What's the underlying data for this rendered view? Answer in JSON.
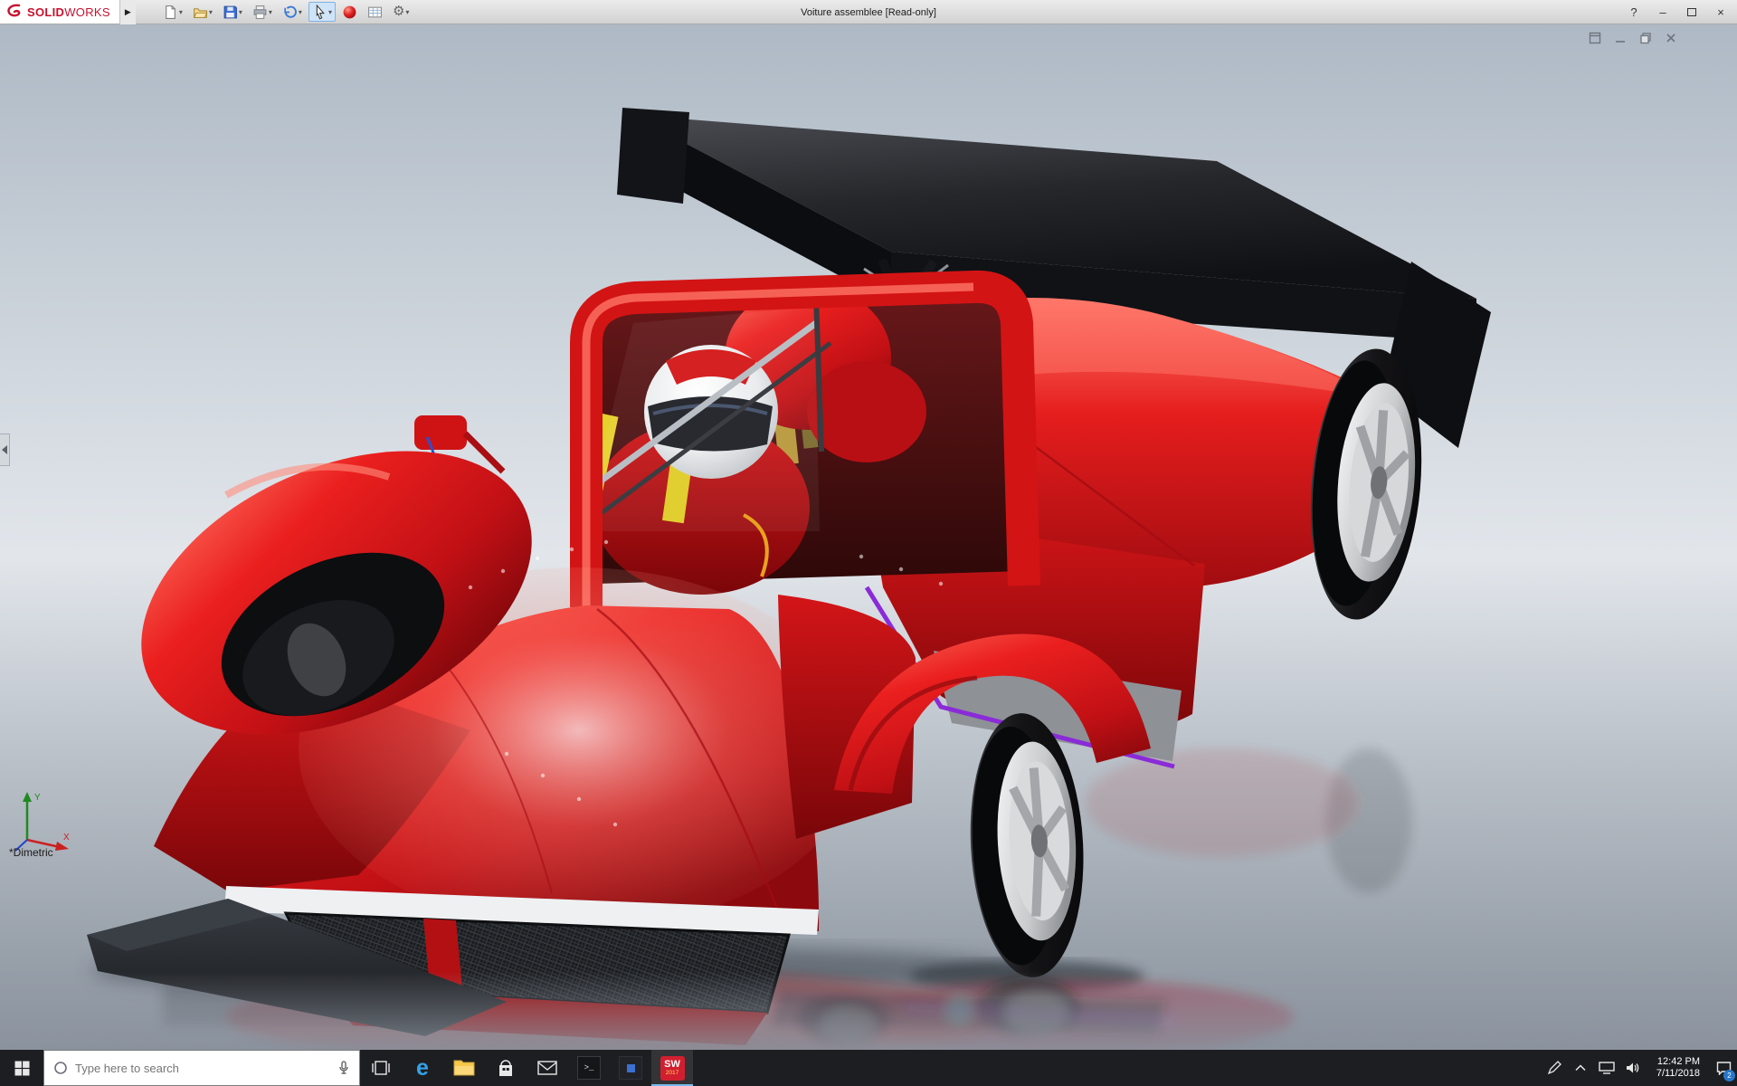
{
  "titlebar": {
    "brand": {
      "solid": "SOLID",
      "works": "WORKS"
    },
    "expand_glyph": "▶",
    "title": "Voiture assemblee [Read-only]",
    "help_label": "?",
    "minimize_label": "–",
    "close_label": "×",
    "toolbar": {
      "dropdown_glyph": "▾",
      "gear_glyph": "⚙",
      "items": [
        "new-document",
        "open",
        "save",
        "print",
        "undo",
        "select",
        "edit-appearance",
        "drawing-sheet",
        "options"
      ]
    }
  },
  "viewport": {
    "view_orientation_label": "*Dimetric",
    "triad": {
      "x_label": "X",
      "y_label": "Y"
    },
    "document_window_controls": [
      "restore-panel",
      "minimize",
      "restore",
      "close"
    ]
  },
  "taskbar": {
    "search_placeholder": "Type here to search",
    "apps": [
      "task-view",
      "edge",
      "file-explorer",
      "store",
      "mail",
      "command-prompt",
      "app-window",
      "solidworks-2017"
    ],
    "edge_glyph": "e",
    "cmd_glyph": ">_",
    "solidworks": {
      "label": "SW",
      "year": "2017"
    },
    "tray": {
      "time": "12:42 PM",
      "date": "7/11/2018",
      "badge": "2"
    }
  },
  "colors": {
    "body_red": "#e01d1d",
    "accent_teal": "#35d8cc",
    "accent_purple": "#8a2bd8",
    "brand_red": "#c8102e",
    "titlebar_bg": "#d8d8d8",
    "taskbar_bg": "#1d1e21"
  }
}
